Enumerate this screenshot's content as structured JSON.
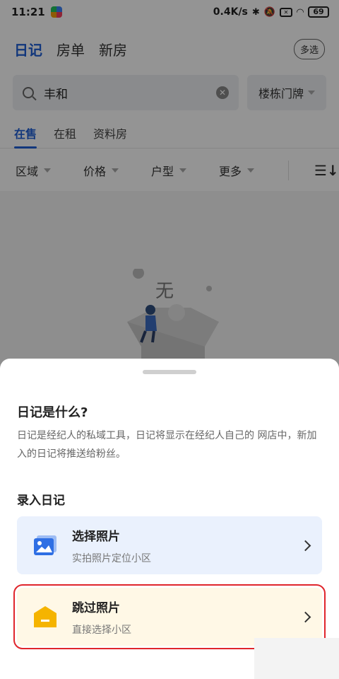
{
  "status_bar": {
    "time": "11:21",
    "speed": "0.4K/s",
    "bluetooth_symbol": "✱",
    "mute_symbol": "🔕",
    "sim_symbol": "✕",
    "wifi_symbol": "◠",
    "battery": "69"
  },
  "top_nav": {
    "tabs": [
      "日记",
      "房单",
      "新房"
    ],
    "multi_select": "多选"
  },
  "search": {
    "query": "丰和",
    "clear_symbol": "✕",
    "building_select": "楼栋门牌"
  },
  "sub_tabs": [
    "在售",
    "在租",
    "资料房"
  ],
  "filters": [
    "区域",
    "价格",
    "户型",
    "更多"
  ],
  "sort_icon_glyph": "☰↓",
  "empty_text": "无",
  "sheet": {
    "title": "日记是什么?",
    "description": "日记是经纪人的私域工具，日记将显示在经纪人自己的 网店中，新加入的日记将推送给粉丝。",
    "section_title": "录入日记",
    "options": [
      {
        "title": "选择照片",
        "subtitle": "实拍照片定位小区",
        "icon": "photo-icon",
        "color": "#2f6fe4"
      },
      {
        "title": "跳过照片",
        "subtitle": "直接选择小区",
        "icon": "house-icon",
        "color": "#f5b400"
      }
    ]
  },
  "colors": {
    "accent": "#1f5fd6",
    "highlight_border": "#e0252b"
  }
}
